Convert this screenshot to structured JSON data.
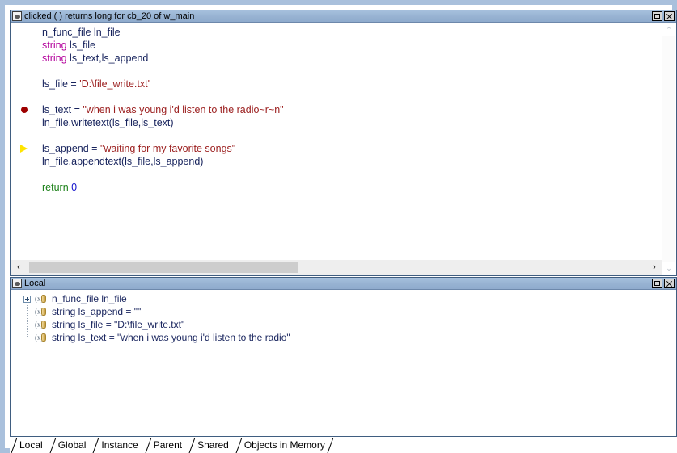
{
  "script_window": {
    "title": "clicked ( )  returns long for cb_20 of w_main",
    "icon": "script-file-icon",
    "buttons": {
      "maximize": "maximize-button",
      "close": "close-button"
    },
    "code_lines": [
      {
        "marker": "none",
        "tokens": [
          {
            "t": "n_func_file ln_file",
            "c": "idn"
          }
        ]
      },
      {
        "marker": "none",
        "tokens": [
          {
            "t": "string ",
            "c": "kw"
          },
          {
            "t": "ls_file",
            "c": "idn"
          }
        ]
      },
      {
        "marker": "none",
        "tokens": [
          {
            "t": "string ",
            "c": "kw"
          },
          {
            "t": "ls_text,ls_append",
            "c": "idn"
          }
        ]
      },
      {
        "marker": "none",
        "tokens": [
          {
            "t": "",
            "c": "idn"
          }
        ]
      },
      {
        "marker": "none",
        "tokens": [
          {
            "t": "ls_file = ",
            "c": "idn"
          },
          {
            "t": "'D:\\file_write.txt'",
            "c": "str"
          }
        ]
      },
      {
        "marker": "none",
        "tokens": [
          {
            "t": "",
            "c": "idn"
          }
        ]
      },
      {
        "marker": "breakpoint",
        "tokens": [
          {
            "t": "ls_text = ",
            "c": "idn"
          },
          {
            "t": "\"when i was young i'd listen to the radio~r~n\"",
            "c": "str"
          }
        ]
      },
      {
        "marker": "none",
        "tokens": [
          {
            "t": "ln_file.writetext(ls_file,ls_text)",
            "c": "idn"
          }
        ]
      },
      {
        "marker": "none",
        "tokens": [
          {
            "t": "",
            "c": "idn"
          }
        ]
      },
      {
        "marker": "current",
        "tokens": [
          {
            "t": "ls_append = ",
            "c": "idn"
          },
          {
            "t": "\"waiting for my favorite songs\"",
            "c": "str"
          }
        ]
      },
      {
        "marker": "none",
        "tokens": [
          {
            "t": "ln_file.appendtext(ls_file,ls_append)",
            "c": "idn"
          }
        ]
      },
      {
        "marker": "none",
        "tokens": [
          {
            "t": "",
            "c": "idn"
          }
        ]
      },
      {
        "marker": "none",
        "tokens": [
          {
            "t": "return ",
            "c": "ret"
          },
          {
            "t": "0",
            "c": "num"
          }
        ]
      }
    ],
    "scrollbars": {
      "v_up": "⌃",
      "v_down": "⌄",
      "h_left": "‹",
      "h_right": "›"
    }
  },
  "local_window": {
    "title": "Local",
    "icon": "script-file-icon",
    "buttons": {
      "maximize": "maximize-button",
      "close": "close-button"
    },
    "rows": [
      {
        "label": "n_func_file ln_file",
        "expandable": true,
        "last": false
      },
      {
        "label": "string ls_append = \"\"",
        "expandable": false,
        "last": false
      },
      {
        "label": "string ls_file = \"D:\\file_write.txt\"",
        "expandable": false,
        "last": false
      },
      {
        "label": "string ls_text = \"when i was young i'd listen to the radio\"",
        "expandable": false,
        "last": true
      }
    ]
  },
  "tabs": [
    {
      "label": "Local",
      "active": true
    },
    {
      "label": "Global",
      "active": false
    },
    {
      "label": "Instance",
      "active": false
    },
    {
      "label": "Parent",
      "active": false
    },
    {
      "label": "Shared",
      "active": false
    },
    {
      "label": "Objects in Memory",
      "active": false
    }
  ],
  "colors": {
    "titlebar": "#9ab5d4",
    "frame": "#a9c0dc",
    "keyword": "#b3009b",
    "string": "#9c2020",
    "return": "#1b8018",
    "number": "#1111cc",
    "identifier": "#16225c",
    "breakpoint": "#9e0000",
    "current_line_arrow": "#ffe400"
  }
}
